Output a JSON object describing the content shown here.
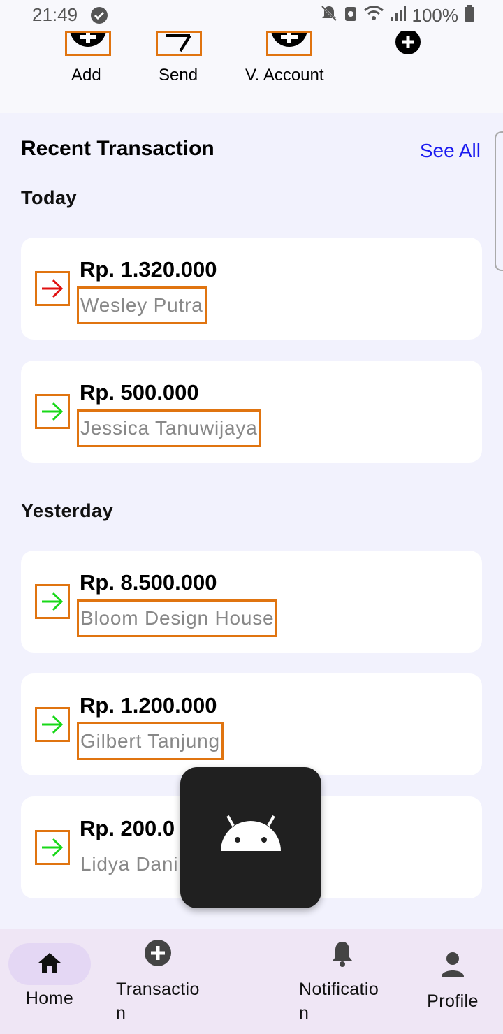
{
  "status_bar": {
    "time": "21:49",
    "battery": "100%"
  },
  "actions": [
    {
      "label": "Add",
      "icon": "plus-circle-icon"
    },
    {
      "label": "Send",
      "icon": "send-arrow-icon"
    },
    {
      "label": "V. Account",
      "icon": "plus-circle-icon"
    },
    {
      "label": "",
      "icon": "plus-circle-icon"
    }
  ],
  "recent": {
    "title": "Recent Transaction",
    "see_all": "See All",
    "groups": [
      {
        "label": "Today",
        "items": [
          {
            "amount": "Rp. 1.320.000",
            "name": "Wesley Putra",
            "direction": "outgoing",
            "arrow_color": "#e01010"
          },
          {
            "amount": "Rp. 500.000",
            "name": "Jessica Tanuwijaya",
            "direction": "incoming",
            "arrow_color": "#18d818"
          }
        ]
      },
      {
        "label": "Yesterday",
        "items": [
          {
            "amount": "Rp. 8.500.000",
            "name": "Bloom Design House",
            "direction": "incoming",
            "arrow_color": "#18d818"
          },
          {
            "amount": "Rp. 1.200.000",
            "name": "Gilbert Tanjung",
            "direction": "incoming",
            "arrow_color": "#18d818"
          },
          {
            "amount": "Rp. 200.0",
            "name": "Lidya Dani",
            "direction": "incoming",
            "arrow_color": "#18d818"
          }
        ]
      }
    ]
  },
  "bottom_nav": [
    {
      "label": "Home",
      "icon": "home-icon",
      "active": true
    },
    {
      "label": "Transactio\nn",
      "icon": "plus-circle-icon"
    },
    {
      "label": "Notificatio\nn",
      "icon": "bell-icon"
    },
    {
      "label": "Profile",
      "icon": "person-icon"
    }
  ],
  "colors": {
    "accent": "#1a1af0",
    "highlight_border": "#e07410",
    "out": "#e01010",
    "in": "#18d818"
  }
}
